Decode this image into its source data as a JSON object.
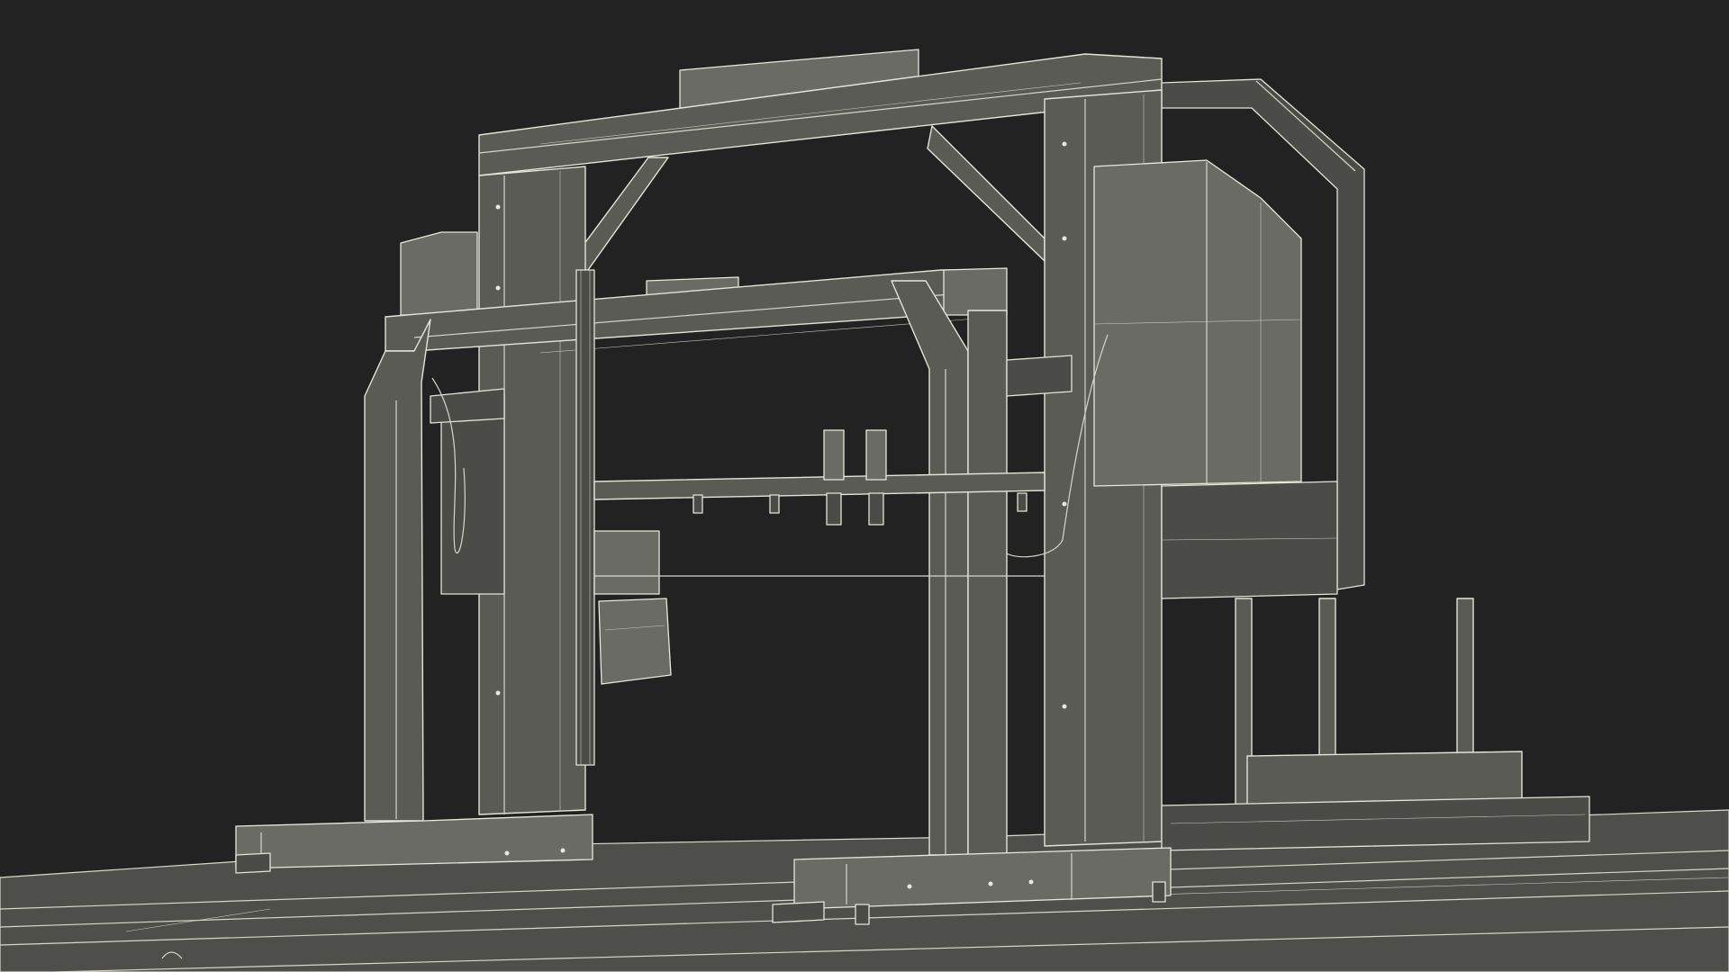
{
  "scene": {
    "subject": "gantry-machine-wireframe-render",
    "background_color": "#222222",
    "surface_color": "#5a5b55",
    "wire_color": "#e4e4d8"
  }
}
